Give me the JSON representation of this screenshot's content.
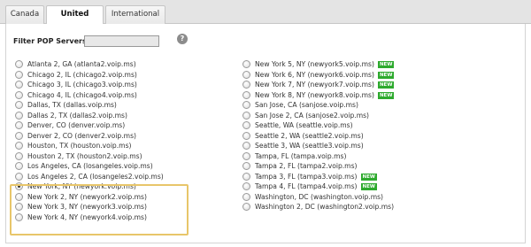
{
  "tabs": [
    "Canada",
    "United States",
    "International"
  ],
  "filter": {
    "label": "Filter POP Servers:",
    "value": ""
  },
  "help_icon": "?",
  "new_badge": "NEW",
  "left_column": [
    {
      "label": "Atlanta 2, GA (atlanta2.voip.ms)",
      "selected": false,
      "new": false
    },
    {
      "label": "Chicago 2, IL (chicago2.voip.ms)",
      "selected": false,
      "new": false
    },
    {
      "label": "Chicago 3, IL (chicago3.voip.ms)",
      "selected": false,
      "new": false
    },
    {
      "label": "Chicago 4, IL (chicago4.voip.ms)",
      "selected": false,
      "new": false
    },
    {
      "label": "Dallas, TX (dallas.voip.ms)",
      "selected": false,
      "new": false
    },
    {
      "label": "Dallas 2, TX (dallas2.voip.ms)",
      "selected": false,
      "new": false
    },
    {
      "label": "Denver, CO (denver.voip.ms)",
      "selected": false,
      "new": false
    },
    {
      "label": "Denver 2, CO (denver2.voip.ms)",
      "selected": false,
      "new": false
    },
    {
      "label": "Houston, TX (houston.voip.ms)",
      "selected": false,
      "new": false
    },
    {
      "label": "Houston 2, TX (houston2.voip.ms)",
      "selected": false,
      "new": false
    },
    {
      "label": "Los Angeles, CA (losangeles.voip.ms)",
      "selected": false,
      "new": false
    },
    {
      "label": "Los Angeles 2, CA (losangeles2.voip.ms)",
      "selected": false,
      "new": false
    },
    {
      "label": "New York, NY (newyork.voip.ms)",
      "selected": true,
      "new": false
    },
    {
      "label": "New York 2, NY (newyork2.voip.ms)",
      "selected": false,
      "new": false
    },
    {
      "label": "New York 3, NY (newyork3.voip.ms)",
      "selected": false,
      "new": false
    },
    {
      "label": "New York 4, NY (newyork4.voip.ms)",
      "selected": false,
      "new": false
    }
  ],
  "right_column": [
    {
      "label": "New York 5, NY (newyork5.voip.ms)",
      "selected": false,
      "new": true
    },
    {
      "label": "New York 6, NY (newyork6.voip.ms)",
      "selected": false,
      "new": true
    },
    {
      "label": "New York 7, NY (newyork7.voip.ms)",
      "selected": false,
      "new": true
    },
    {
      "label": "New York 8, NY (newyork8.voip.ms)",
      "selected": false,
      "new": true
    },
    {
      "label": "San Jose, CA (sanjose.voip.ms)",
      "selected": false,
      "new": false
    },
    {
      "label": "San Jose 2, CA (sanjose2.voip.ms)",
      "selected": false,
      "new": false
    },
    {
      "label": "Seattle, WA (seattle.voip.ms)",
      "selected": false,
      "new": false
    },
    {
      "label": "Seattle 2, WA (seattle2.voip.ms)",
      "selected": false,
      "new": false
    },
    {
      "label": "Seattle 3, WA (seattle3.voip.ms)",
      "selected": false,
      "new": false
    },
    {
      "label": "Tampa, FL (tampa.voip.ms)",
      "selected": false,
      "new": false
    },
    {
      "label": "Tampa 2, FL (tampa2.voip.ms)",
      "selected": false,
      "new": false
    },
    {
      "label": "Tampa 3, FL (tampa3.voip.ms)",
      "selected": false,
      "new": true
    },
    {
      "label": "Tampa 4, FL (tampa4.voip.ms)",
      "selected": false,
      "new": true
    },
    {
      "label": "Washington, DC (washington.voip.ms)",
      "selected": false,
      "new": false
    },
    {
      "label": "Washington 2, DC (washington2.voip.ms)",
      "selected": false,
      "new": false
    }
  ]
}
